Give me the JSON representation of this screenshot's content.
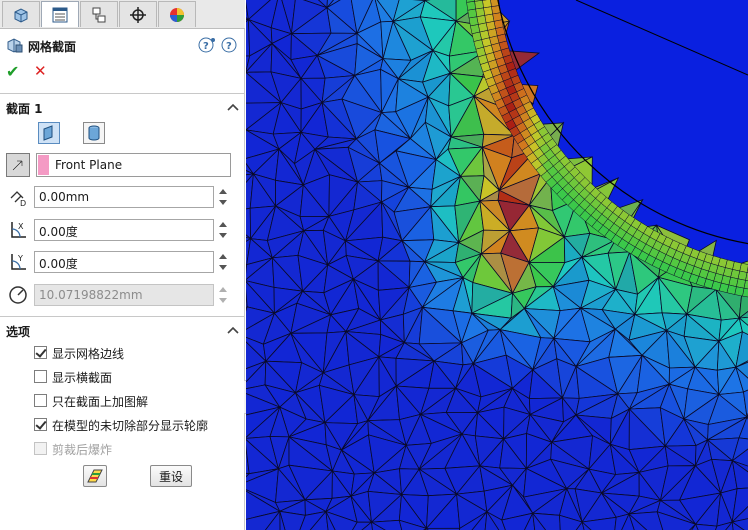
{
  "feature": {
    "title": "网格截面"
  },
  "section1": {
    "title": "截面 1",
    "plane": "Front Plane"
  },
  "fields": {
    "offset": "0.00mm",
    "angle_x": "0.00度",
    "angle_y": "0.00度",
    "radius": "10.07198822mm"
  },
  "options": {
    "title": "选项",
    "items": [
      {
        "label": "显示网格边线",
        "checked": true,
        "disabled": false
      },
      {
        "label": "显示横截面",
        "checked": false,
        "disabled": false
      },
      {
        "label": "只在截面上加图解",
        "checked": false,
        "disabled": false
      },
      {
        "label": "在模型的未切除部分显示轮廓",
        "checked": true,
        "disabled": false
      },
      {
        "label": "剪裁后爆炸",
        "checked": false,
        "disabled": true
      }
    ],
    "reset_label": "重设"
  },
  "colors": {
    "accent": "#1f9e2a",
    "cancel": "#dd2222",
    "plane_swatch": "#f49ac4",
    "viewport_background": "#0a20e0"
  },
  "icons": {
    "tabs": [
      "feature-manager-icon",
      "property-manager-icon",
      "configuration-manager-icon",
      "dimxpert-icon",
      "display-manager-icon"
    ]
  }
}
